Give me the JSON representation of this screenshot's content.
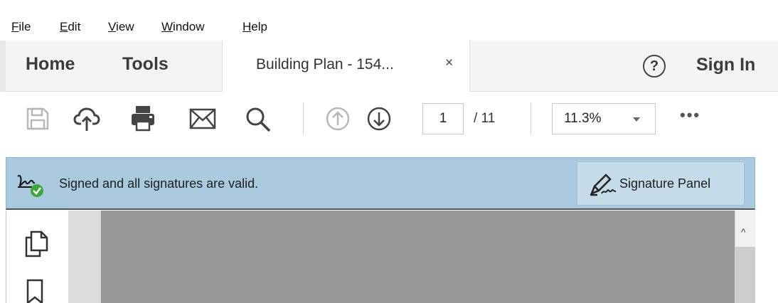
{
  "menu": {
    "file": {
      "first": "F",
      "rest": "ile"
    },
    "edit": {
      "first": "E",
      "rest": "dit"
    },
    "view": {
      "first": "V",
      "rest": "iew"
    },
    "window": {
      "first": "W",
      "rest": "indow"
    },
    "help": {
      "first": "H",
      "rest": "elp"
    }
  },
  "tabs": {
    "home": "Home",
    "tools": "Tools",
    "document": "Building Plan - 154...",
    "close": "×",
    "help": "?",
    "sign_in": "Sign In"
  },
  "toolbar": {
    "page_current": "1",
    "page_total": "/ 11",
    "zoom": "11.3%",
    "more": "•••",
    "icons": [
      "save-icon",
      "cloud-upload-icon",
      "print-icon",
      "email-icon",
      "search-icon",
      "page-up-icon",
      "page-down-icon"
    ]
  },
  "signature_bar": {
    "message": "Signed and all signatures are valid.",
    "button_label": "Signature Panel",
    "status_color": "#3aa83a",
    "background": "#a9c9de"
  },
  "sidebar": {
    "icons": [
      "copy-pages-icon",
      "bookmark-icon"
    ]
  },
  "scrollbar": {
    "up_arrow": "^"
  }
}
